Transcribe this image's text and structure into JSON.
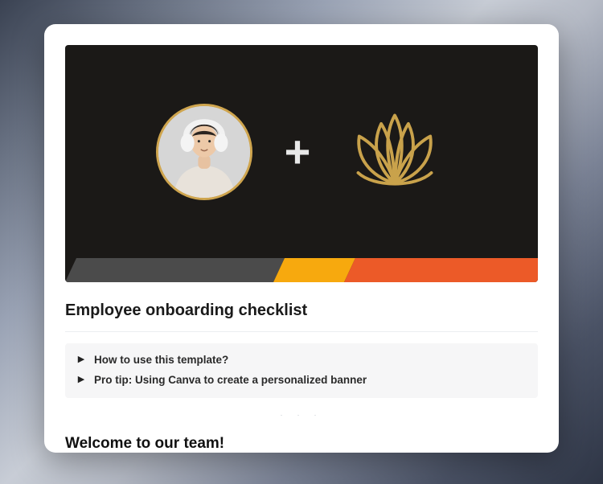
{
  "banner": {
    "plus_glyph": "+",
    "colors": {
      "bg": "#1b1917",
      "ring": "#cfa54e",
      "stripe_dark": "#4b4b4b",
      "stripe_yellow": "#f7a90e",
      "stripe_orange": "#ec5a28",
      "logo": "#c9a24b"
    }
  },
  "title": "Employee onboarding checklist",
  "toggles": [
    {
      "label": "How to use this template?"
    },
    {
      "label": "Pro tip: Using Canva to create a personalized banner"
    }
  ],
  "divider_dots": ". . .",
  "section_heading": "Welcome to our team!"
}
